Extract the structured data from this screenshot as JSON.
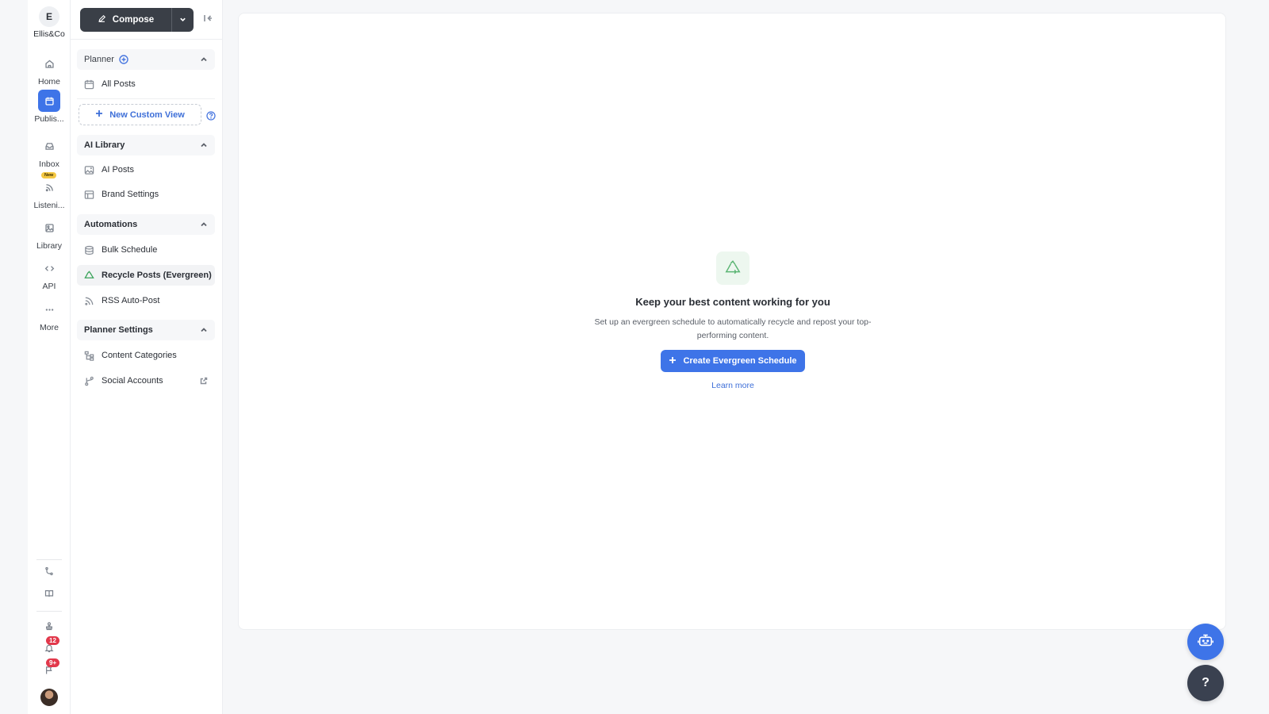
{
  "brand": {
    "initial": "E",
    "name": "Ellis&Co"
  },
  "rail": {
    "items": [
      {
        "label": "Home",
        "icon": "home-icon"
      },
      {
        "label": "Publis...",
        "icon": "calendar-icon"
      },
      {
        "label": "Inbox",
        "icon": "inbox-icon"
      },
      {
        "label": "Listeni...",
        "icon": "rss-icon",
        "badge": "New"
      },
      {
        "label": "Library",
        "icon": "image-library-icon"
      },
      {
        "label": "API",
        "icon": "code-icon"
      },
      {
        "label": "More",
        "icon": "more-dots-icon"
      }
    ],
    "notification_count": "12",
    "feedback_count": "9+"
  },
  "sidebar": {
    "compose_label": "Compose",
    "planner": {
      "title": "Planner",
      "all_posts": "All Posts",
      "new_custom_view": "New Custom View"
    },
    "ai_library": {
      "title": "AI Library",
      "items": [
        "AI Posts",
        "Brand Settings"
      ]
    },
    "automations": {
      "title": "Automations",
      "items": [
        "Bulk Schedule",
        "Recycle Posts (Evergreen)",
        "RSS Auto-Post"
      ]
    },
    "planner_settings": {
      "title": "Planner Settings",
      "items": [
        "Content Categories",
        "Social Accounts"
      ]
    }
  },
  "main": {
    "empty_icon": "recycle-icon",
    "title": "Keep your best content working for you",
    "description": "Set up an evergreen schedule to automatically recycle and repost your top-performing content.",
    "cta_label": "Create Evergreen Schedule",
    "learn_more": "Learn more"
  },
  "fab": {
    "help_label": "?"
  },
  "colors": {
    "accent": "#3e74e8",
    "compose_bg": "#3a3f47",
    "recycle_green": "#5bb573",
    "badge_red": "#e2384b",
    "badge_yellow": "#f4c843"
  }
}
